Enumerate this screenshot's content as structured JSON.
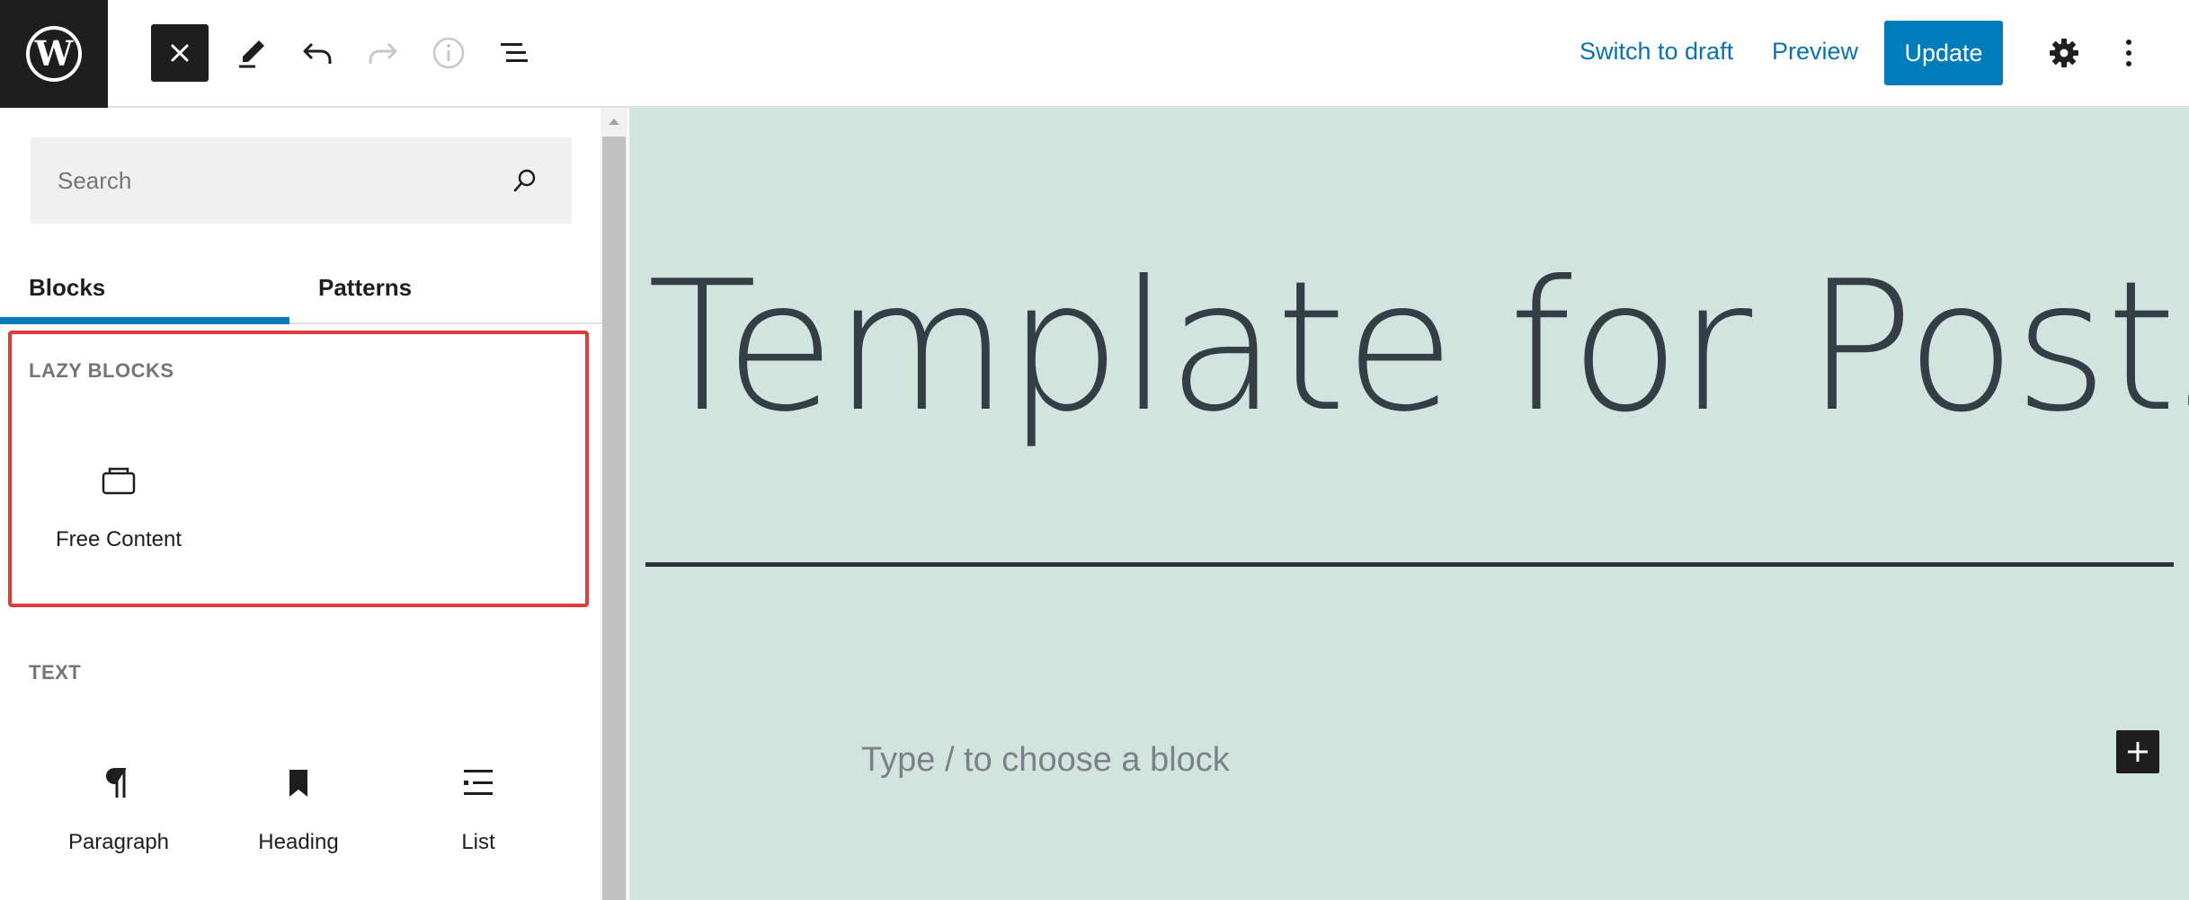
{
  "toolbar": {
    "switch_to_draft": "Switch to draft",
    "preview": "Preview",
    "update": "Update"
  },
  "inserter": {
    "search": {
      "placeholder": "Search",
      "value": ""
    },
    "tabs": [
      {
        "label": "Blocks",
        "active": true
      },
      {
        "label": "Patterns",
        "active": false
      }
    ],
    "categories": [
      {
        "title": "LAZY BLOCKS",
        "highlighted": true,
        "blocks": [
          {
            "label": "Free Content",
            "icon": "free-content-icon"
          }
        ]
      },
      {
        "title": "TEXT",
        "highlighted": false,
        "blocks": [
          {
            "label": "Paragraph",
            "icon": "paragraph-icon"
          },
          {
            "label": "Heading",
            "icon": "heading-icon"
          },
          {
            "label": "List",
            "icon": "list-icon"
          }
        ]
      }
    ]
  },
  "canvas": {
    "title": "Template for Posts",
    "placeholder": "Type / to choose a block"
  },
  "colors": {
    "accent": "#007cba",
    "canvas_bg": "#d2e4de",
    "highlight_border": "#dc3c3c",
    "dark": "#1e1e1e"
  }
}
